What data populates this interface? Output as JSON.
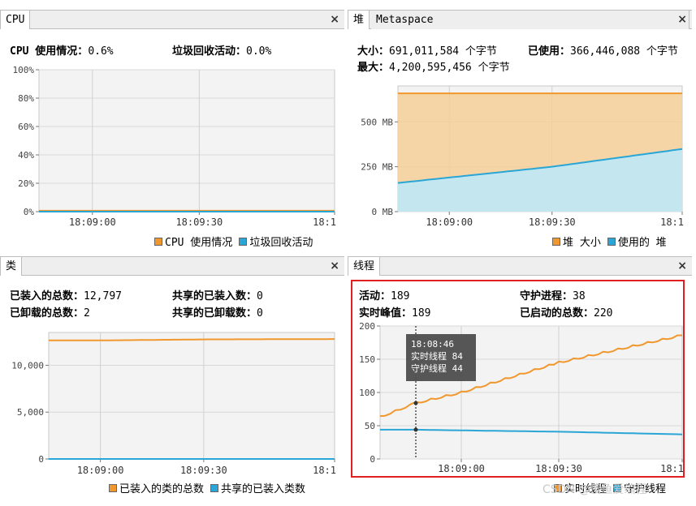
{
  "colors": {
    "orange": "#f0982e",
    "orange_fill": "#f5cf96",
    "blue": "#2aa6d6",
    "blue_fill": "#bfe8f7",
    "red_highlight": "#e02020"
  },
  "cpu": {
    "tab": "CPU",
    "close": "×",
    "stat1_label": "CPU 使用情况：",
    "stat1_value": "0.6%",
    "stat2_label": "垃圾回收活动：",
    "stat2_value": "0.0%",
    "legend": [
      "CPU 使用情况",
      "垃圾回收活动"
    ]
  },
  "heap": {
    "tab_active": "堆",
    "tab_inactive": "Metaspace",
    "close": "×",
    "size_label": "大小：",
    "size_value": "691,011,584 个字节",
    "used_label": "已使用：",
    "used_value": "366,446,088 个字节",
    "max_label": "最大：",
    "max_value": "4,200,595,456 个字节",
    "legend": [
      "堆 大小",
      "使用的 堆"
    ]
  },
  "classes": {
    "tab": "类",
    "close": "×",
    "loaded_label": "已装入的总数：",
    "loaded_value": "12,797",
    "shared_loaded_label": "共享的已装入数：",
    "shared_loaded_value": "0",
    "unloaded_label": "已卸载的总数：",
    "unloaded_value": "2",
    "shared_unloaded_label": "共享的已卸载数：",
    "shared_unloaded_value": "0",
    "legend": [
      "已装入的类的总数",
      "共享的已装入类数"
    ]
  },
  "threads": {
    "tab": "线程",
    "close": "×",
    "live_label": "活动：",
    "live_value": "189",
    "daemon_label": "守护进程：",
    "daemon_value": "38",
    "peak_label": "实时峰值：",
    "peak_value": "189",
    "started_label": "已启动的总数：",
    "started_value": "220",
    "legend": [
      "实时线程",
      "守护线程"
    ],
    "tooltip": {
      "time": "18:08:46",
      "live": "实时线程  84",
      "daemon": "守护线程  44"
    }
  },
  "watermark": "CSDN @傻鱼爱编程",
  "chart_data": [
    {
      "type": "line",
      "name": "cpu",
      "x": [
        "18:08:45",
        "18:09:00",
        "18:09:30",
        "18:10:00"
      ],
      "xticks": [
        "18:09:00",
        "18:09:30",
        "18:1"
      ],
      "yticks": [
        "100%",
        "80%",
        "60%",
        "40%",
        "20%",
        "0%"
      ],
      "ylim": [
        0,
        100
      ],
      "series": [
        {
          "name": "CPU 使用情况",
          "values": [
            0.6,
            0.6,
            0.6,
            0.6
          ]
        },
        {
          "name": "垃圾回收活动",
          "values": [
            0,
            0,
            0,
            0
          ]
        }
      ]
    },
    {
      "type": "area",
      "name": "heap",
      "x": [
        "18:08:45",
        "18:09:00",
        "18:09:30",
        "18:10:00"
      ],
      "xticks": [
        "18:09:00",
        "18:09:30",
        "18:1"
      ],
      "yticks": [
        "500 MB",
        "250 MB",
        "0 MB"
      ],
      "ylim": [
        0,
        700
      ],
      "series": [
        {
          "name": "堆 大小",
          "values": [
            659,
            659,
            659,
            659
          ]
        },
        {
          "name": "使用的 堆",
          "values": [
            160,
            190,
            250,
            349
          ]
        }
      ]
    },
    {
      "type": "line",
      "name": "classes",
      "x": [
        "18:08:45",
        "18:09:00",
        "18:09:30",
        "18:10:00"
      ],
      "xticks": [
        "18:09:00",
        "18:09:30",
        "18:1"
      ],
      "yticks": [
        "10,000",
        "5,000",
        "0"
      ],
      "ylim": [
        0,
        13500
      ],
      "series": [
        {
          "name": "已装入的类的总数",
          "values": [
            12650,
            12650,
            12760,
            12797
          ]
        },
        {
          "name": "共享的已装入类数",
          "values": [
            0,
            0,
            0,
            0
          ]
        }
      ]
    },
    {
      "type": "line",
      "name": "threads",
      "x": [
        "18:08:35",
        "18:08:46",
        "18:09:00",
        "18:09:30",
        "18:10:00"
      ],
      "xticks": [
        "18:09:00",
        "18:09:30",
        "18:1"
      ],
      "yticks": [
        "200",
        "150",
        "100",
        "50",
        "0"
      ],
      "ylim": [
        0,
        200
      ],
      "series": [
        {
          "name": "实时线程",
          "values": [
            63,
            84,
            100,
            145,
            186
          ]
        },
        {
          "name": "守护线程",
          "values": [
            44,
            44,
            43,
            41,
            37
          ]
        }
      ]
    }
  ]
}
